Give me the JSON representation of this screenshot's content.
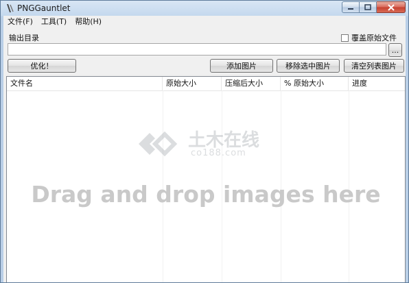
{
  "window": {
    "title": "PNGGauntlet"
  },
  "menu": {
    "file": "文件(F)",
    "tools": "工具(T)",
    "help": "帮助(H)"
  },
  "output": {
    "label": "输出目录",
    "overwrite_label": "覆盖原始文件",
    "value": "",
    "browse_label": "..."
  },
  "buttons": {
    "optimize": "优化！",
    "add": "添加图片",
    "remove": "移除选中图片",
    "clear": "清空列表图片"
  },
  "table": {
    "columns": [
      "文件名",
      "原始大小",
      "压缩后大小",
      "% 原始大小",
      "进度"
    ]
  },
  "watermark": {
    "text": "土木在线",
    "sub": "co188.com"
  },
  "drop_hint": "Drag and drop images here"
}
